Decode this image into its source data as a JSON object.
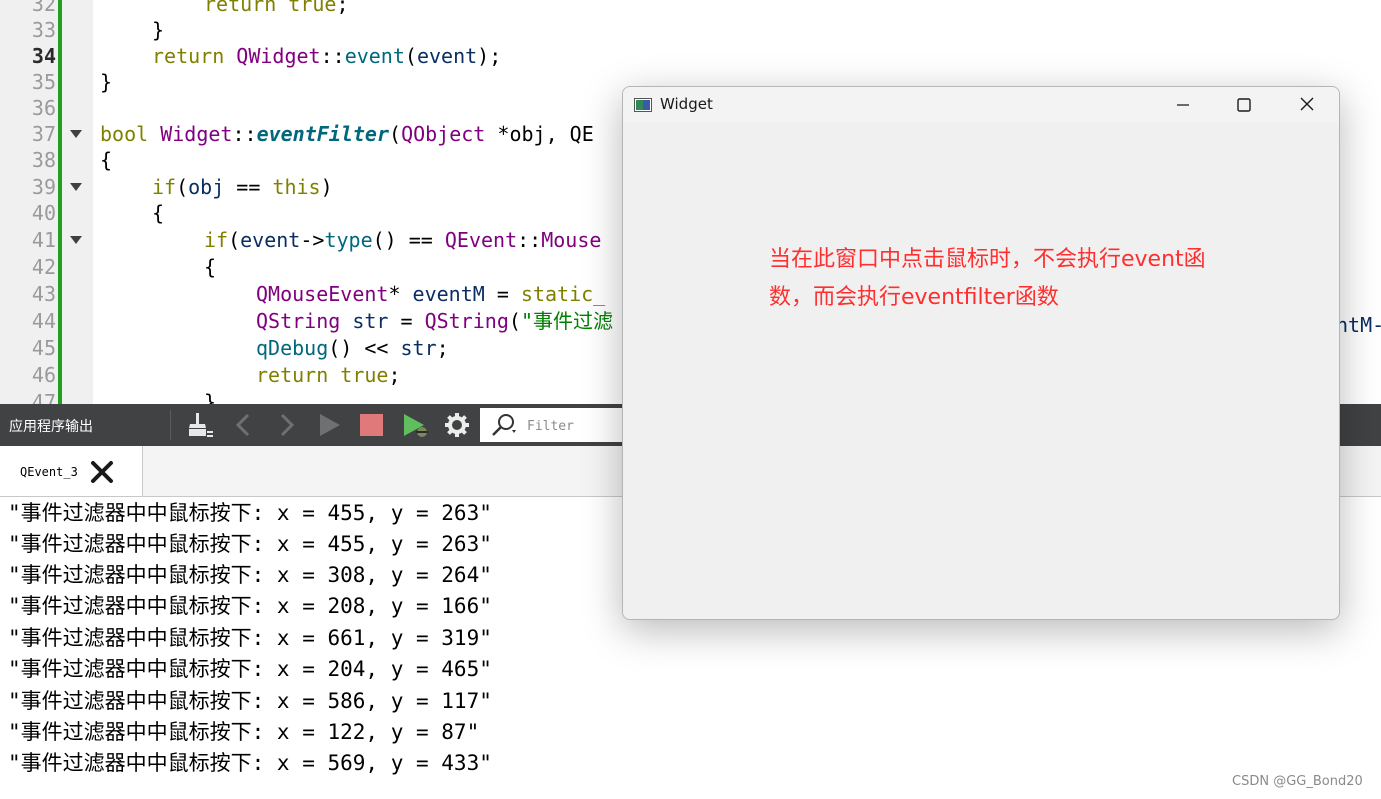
{
  "editor": {
    "lines": [
      {
        "n": "32",
        "current": false,
        "fold": false
      },
      {
        "n": "33",
        "current": false,
        "fold": false
      },
      {
        "n": "34",
        "current": true,
        "fold": false
      },
      {
        "n": "35",
        "current": false,
        "fold": false
      },
      {
        "n": "36",
        "current": false,
        "fold": false
      },
      {
        "n": "37",
        "current": false,
        "fold": true
      },
      {
        "n": "38",
        "current": false,
        "fold": false
      },
      {
        "n": "39",
        "current": false,
        "fold": true
      },
      {
        "n": "40",
        "current": false,
        "fold": false
      },
      {
        "n": "41",
        "current": false,
        "fold": true
      },
      {
        "n": "42",
        "current": false,
        "fold": false
      },
      {
        "n": "43",
        "current": false,
        "fold": false
      },
      {
        "n": "44",
        "current": false,
        "fold": false
      },
      {
        "n": "45",
        "current": false,
        "fold": false
      },
      {
        "n": "46",
        "current": false,
        "fold": false
      },
      {
        "n": "47",
        "current": false,
        "fold": false
      }
    ],
    "code": {
      "l32": {
        "kw": "return",
        "v": "true",
        "p": ";"
      },
      "l33": {
        "p": "}"
      },
      "l34": {
        "kw": "return",
        "ty": "QWidget",
        "s1": "::",
        "fn": "event",
        "p1": "(",
        "v": "event",
        "p2": ");"
      },
      "l35": {
        "p": "}"
      },
      "l37": {
        "kw": "bool",
        "ty": "Widget",
        "s1": "::",
        "fn": "eventFilter",
        "p1": "(",
        "ty2": "QObject",
        "v": " *obj, QE"
      },
      "l38": {
        "p": "{"
      },
      "l39": {
        "kw": "if",
        "p1": "(",
        "v": "obj",
        "op": " == ",
        "kw2": "this",
        "p2": ")"
      },
      "l40": {
        "p": "{"
      },
      "l41": {
        "kw": "if",
        "p1": "(",
        "v": "event",
        "op": "->",
        "fn": "type",
        "p2": "() == ",
        "ty": "QEvent",
        "s1": "::",
        "v2": "Mouse"
      },
      "l42": {
        "p": "{"
      },
      "l43": {
        "ty": "QMouseEvent",
        "p1": "* ",
        "v": "eventM",
        "p2": " = ",
        "kw": "static_"
      },
      "l44": {
        "ty": "QString",
        "v": " str",
        "p1": " = ",
        "ty2": "QString",
        "p2": "(",
        "st": "\"事件过滤"
      },
      "l44_tail": "ntM-",
      "l45": {
        "fn": "qDebug",
        "p1": "() << ",
        "v": "str",
        "p2": ";"
      },
      "l46": {
        "kw": "return",
        "kw2": "true",
        "p": ";"
      },
      "l47": {
        "p": "}"
      }
    }
  },
  "output_pane": {
    "title": "应用程序输出",
    "filter_placeholder": "Filter",
    "tab_label": "QEvent_3",
    "toolbar_icons": [
      "clear-icon",
      "prev-icon",
      "next-icon",
      "run-icon",
      "stop-icon",
      "debug-run-icon",
      "settings-icon",
      "search-icon"
    ],
    "lines": [
      "\"事件过滤器中中鼠标按下: x = 455, y = 263\"",
      "\"事件过滤器中中鼠标按下: x = 455, y = 263\"",
      "\"事件过滤器中中鼠标按下: x = 308, y = 264\"",
      "\"事件过滤器中中鼠标按下: x = 208, y = 166\"",
      "\"事件过滤器中中鼠标按下: x = 661, y = 319\"",
      "\"事件过滤器中中鼠标按下: x = 204, y = 465\"",
      "\"事件过滤器中中鼠标按下: x = 586, y = 117\"",
      "\"事件过滤器中中鼠标按下: x = 122, y = 87\"",
      "\"事件过滤器中中鼠标按下: x = 569, y = 433\""
    ]
  },
  "widget_window": {
    "title": "Widget",
    "note_line1": "当在此窗口中点击鼠标时，不会执行event函",
    "note_line2": "数，而会执行eventfilter函数",
    "note_color": "#ff2f2f"
  },
  "watermark": "CSDN @GG_Bond20"
}
